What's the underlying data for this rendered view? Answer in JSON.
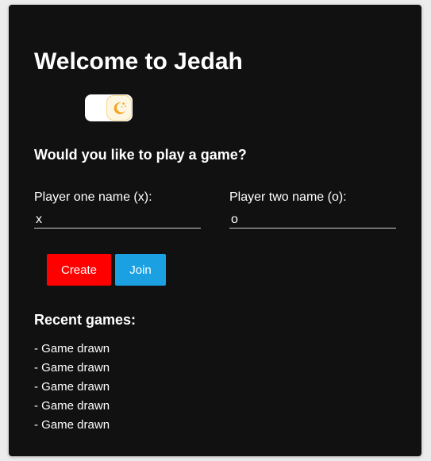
{
  "header": {
    "title": "Welcome to Jedah"
  },
  "theme_toggle": {
    "icon": "moon-stars-icon",
    "track_color": "#ffffff",
    "icon_color": "#f5a623"
  },
  "prompt": "Would you like to play a game?",
  "players": {
    "one": {
      "label": "Player one name (x):",
      "value": "x"
    },
    "two": {
      "label": "Player two name (o):",
      "value": "o"
    }
  },
  "actions": {
    "create_label": "Create",
    "create_color": "#ff0000",
    "join_label": "Join",
    "join_color": "#1ba1e2"
  },
  "recent": {
    "title": "Recent games:",
    "items": [
      "- Game drawn",
      "- Game drawn",
      "- Game drawn",
      "- Game drawn",
      "- Game drawn"
    ]
  }
}
